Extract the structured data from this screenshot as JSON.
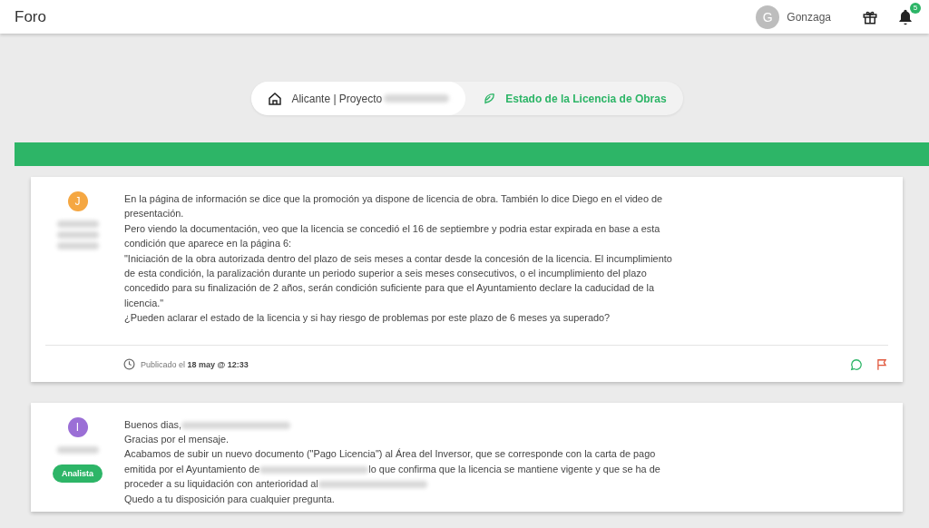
{
  "header": {
    "title": "Foro",
    "user": {
      "initial": "G",
      "name": "Gonzaga"
    },
    "notifications": "5"
  },
  "breadcrumb": [
    {
      "kind": "home",
      "parts": [
        {
          "kind": "text",
          "text": "Alicante | Proyecto"
        },
        {
          "kind": "redacted"
        }
      ],
      "selected": false
    },
    {
      "kind": "topic",
      "parts": [
        {
          "kind": "text",
          "text": "Estado de la Licencia de Obras"
        }
      ],
      "selected": true
    }
  ],
  "posts": [
    {
      "avatar": {
        "initial": "J",
        "color": "#f5a742"
      },
      "author": [
        {
          "kind": "redacted"
        },
        {
          "kind": "redacted"
        },
        {
          "kind": "redacted"
        }
      ],
      "lines": [
        [
          {
            "kind": "text",
            "text": "En la página de información se dice que la promoción ya dispone de licencia de obra. También lo dice Diego en el video de presentación."
          }
        ],
        [
          {
            "kind": "text",
            "text": "Pero viendo la documentación, veo que la licencia se concedió el 16 de septiembre y podria estar expirada en base a esta condición que aparece en la página 6:"
          }
        ],
        [
          {
            "kind": "text",
            "text": "\"Iniciación de la obra autorizada dentro del plazo de seis meses a contar desde la concesión de la licencia. El incumplimiento de esta condición, la paralización durante un periodo superior a seis meses consecutivos, o el incumplimiento del plazo concedido para su finalización de 2 años, serán condición suficiente para que el Ayuntamiento declare la caducidad de la licencia.\""
          }
        ],
        [
          {
            "kind": "text",
            "text": "¿Pueden aclarar el estado de la licencia y si hay riesgo de problemas por este plazo de 6 meses ya superado?"
          }
        ]
      ],
      "published": "Publicado el **18 may @ 12:33**"
    },
    {
      "avatar": {
        "initial": "I",
        "color": "#9b6fd6"
      },
      "author": [
        {
          "kind": "redacted"
        }
      ],
      "role": "Analista",
      "lines": [
        [
          {
            "kind": "text",
            "text": "Buenos dias,"
          },
          {
            "kind": "redacted"
          }
        ],
        [
          {
            "kind": "text",
            "text": "Gracias por el mensaje."
          }
        ],
        [
          {
            "kind": "text",
            "text": "Acabamos de subir un nuevo documento (\"Pago Licencia\") al Área del Inversor, que se corresponde con la carta de pago emitida por el Ayuntamiento de"
          },
          {
            "kind": "redacted"
          },
          {
            "kind": "text",
            "text": "lo que confirma que la licencia se mantiene vigente y que se ha de proceder a su liquidación con anterioridad al"
          },
          {
            "kind": "redacted"
          }
        ],
        [
          {
            "kind": "text",
            "text": "Quedo a tu disposición para cualquier pregunta."
          }
        ]
      ]
    }
  ]
}
